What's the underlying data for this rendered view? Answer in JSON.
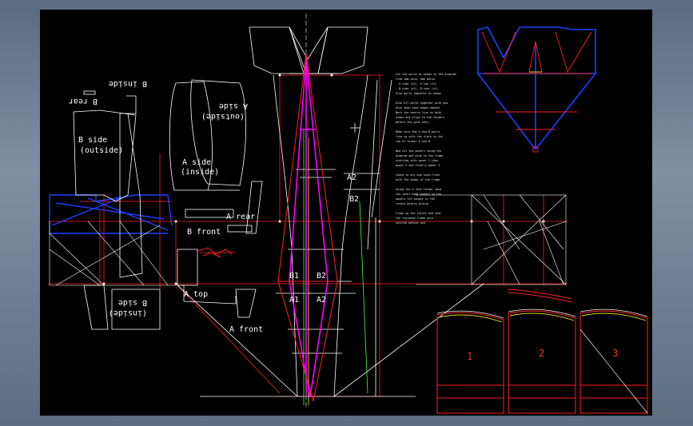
{
  "colors": {
    "background": "#000000",
    "outline": "#ffffff",
    "guide": "#ff2020",
    "spar": "#ff00ff",
    "former": "#2040ff",
    "glide": "#ffe800",
    "green": "#40ff40"
  },
  "labels": {
    "b_rear": "B rear",
    "b_inside_top": "B inside",
    "b_side_outside": "B side\n(outside)",
    "a_side_outside": "A side\n(outside)",
    "a_side_inside": "A side\n(inside)",
    "a2_upper": "A2",
    "b2_upper": "B2",
    "a_rear": "A rear",
    "b_front": "B front",
    "b1": "B1",
    "b2": "B2",
    "a1": "A1",
    "a2": "A2",
    "a_top": "A top",
    "a_front": "A front",
    "b_side_inside": "B side\n(inside)",
    "panel_1": "1",
    "panel_2": "2",
    "panel_3": "3"
  },
  "notes": [
    "Cut the parts as shown in the diagram",
    "from 1mm card, 3mm balsa",
    "- A side (x2), A top (x1)",
    "- B side (x2), B rear (x1)",
    "Glue parts together as shown",
    "",
    "Glue all parts together with pva",
    "glue then sand edges smooth",
    "Mark the centre line on both",
    "sides and align to the formers",
    "before the glue sets.",
    "",
    "Make sure the A and B parts",
    "line up with the slots in the",
    "top of former A and B",
    "",
    "Now cut the panels using the",
    "diagram and glue to the frame",
    "starting with panel 1 then",
    "panel 2 and finally panel 3",
    "",
    "Leave to dry and sand flush",
    "with the edges of the frame",
    "",
    "Using the A rear former sand",
    "the inner edge smooth so the",
    "panels fit snugly in the",
    "recess before gluing",
    "",
    "Clean up the joints and seal",
    "the finished frame with",
    "varnish before use."
  ]
}
